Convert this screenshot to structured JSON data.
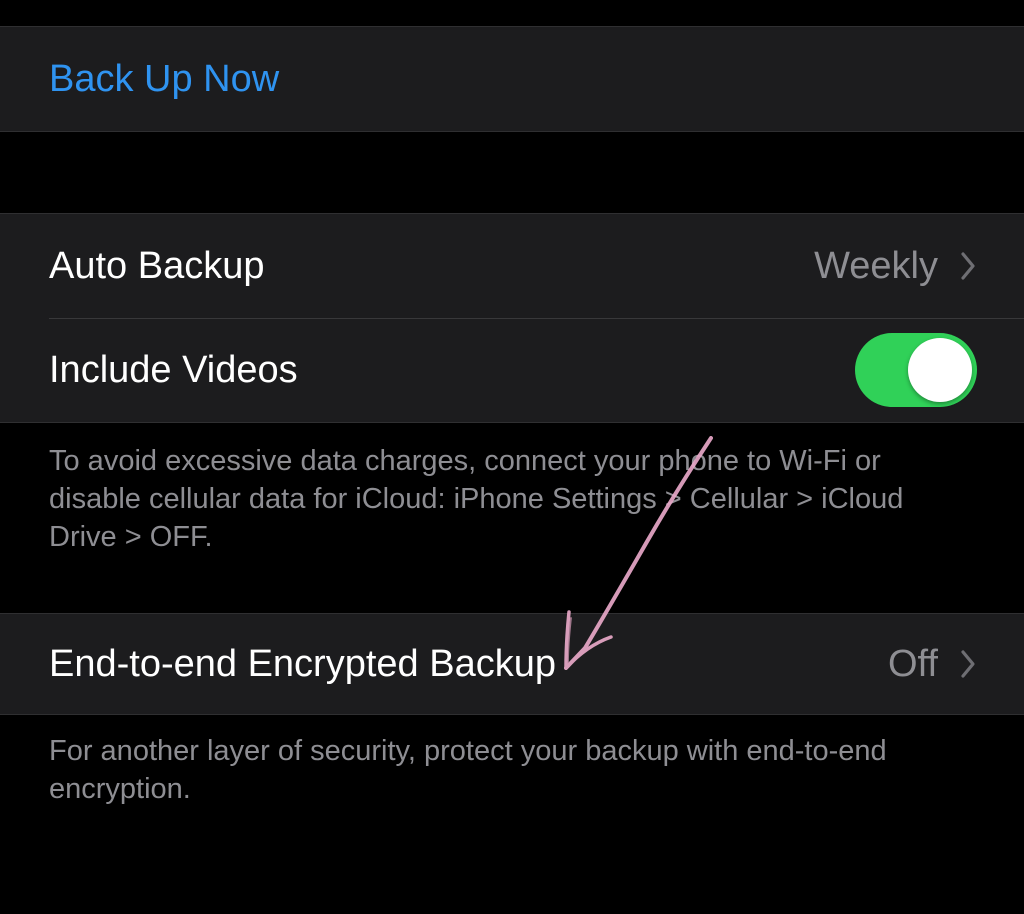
{
  "backup_now": {
    "label": "Back Up Now"
  },
  "auto_backup": {
    "label": "Auto Backup",
    "value": "Weekly"
  },
  "include_videos": {
    "label": "Include Videos",
    "enabled": true
  },
  "data_charges_note": "To avoid excessive data charges, connect your phone to Wi-Fi or disable cellular data for iCloud: iPhone Settings > Cellular > iCloud Drive > OFF.",
  "e2e_backup": {
    "label": "End-to-end Encrypted Backup",
    "value": "Off"
  },
  "e2e_note": "For another layer of security, protect your backup with end-to-end encryption.",
  "colors": {
    "link": "#2f93f0",
    "toggle_on": "#30d158",
    "annotation_arrow": "#e8a8c8"
  },
  "icons": {
    "row_disclosure": "chevron-right-icon",
    "annotation": "hand-drawn-arrow-icon"
  }
}
